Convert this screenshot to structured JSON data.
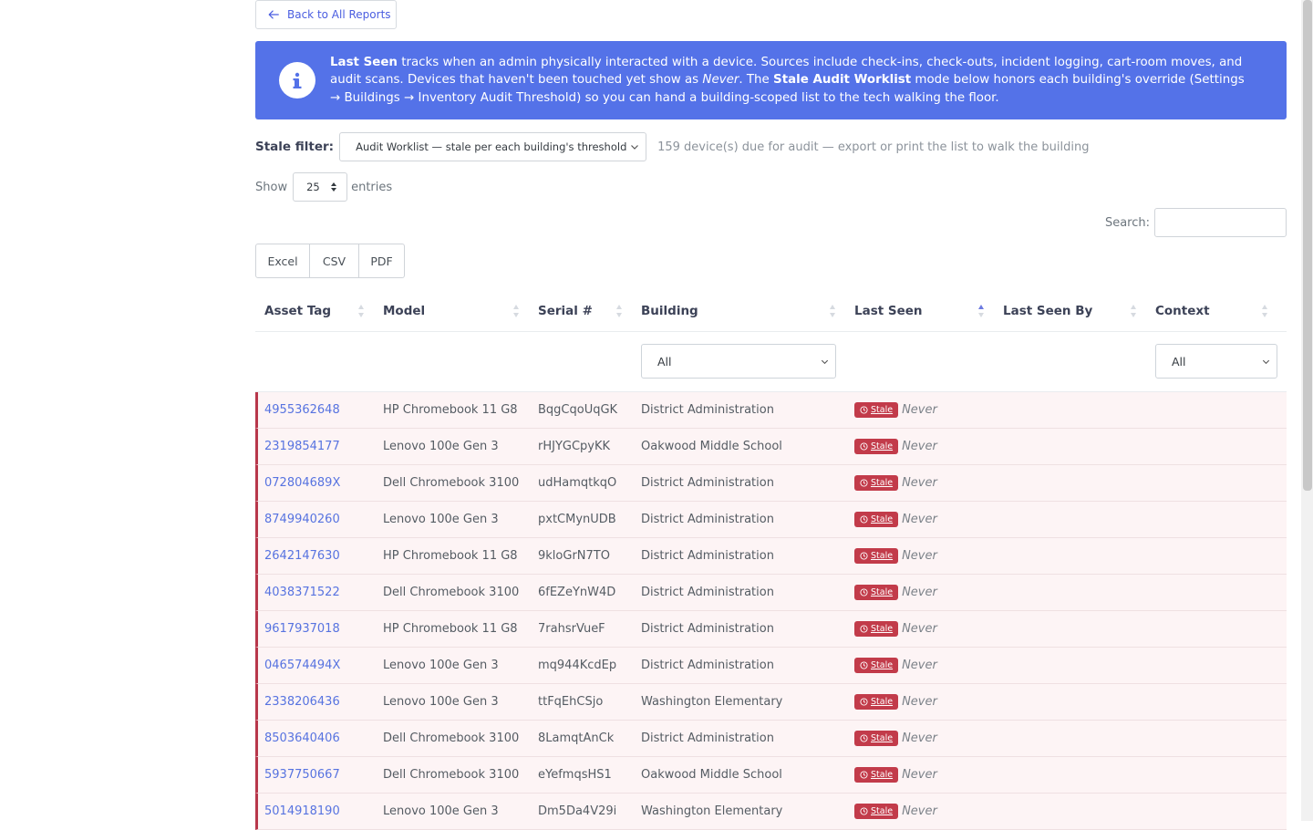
{
  "back_button": {
    "label": "Back to All Reports"
  },
  "info": {
    "term_last_seen": "Last Seen",
    "text_1": " tracks when an admin physically interacted with a device. Sources include check-ins, check-outs, incident logging, cart-room moves, and audit scans. Devices that haven't been touched yet show as ",
    "never_word": "Never",
    "text_2": ". The ",
    "term_audit": "Stale Audit Worklist",
    "text_3": " mode below honors each building's override (Settings → Buildings → Inventory Audit Threshold) so you can hand a building-scoped list to the tech walking the floor."
  },
  "stale_filter": {
    "label": "Stale filter:",
    "selected": "Audit Worklist — stale per each building's threshold",
    "note": "159 device(s) due for audit — export or print the list to walk the building"
  },
  "length_menu": {
    "show": "Show",
    "value": "25",
    "entries": "entries"
  },
  "search": {
    "label": "Search:"
  },
  "export_buttons": [
    "Excel",
    "CSV",
    "PDF"
  ],
  "columns": [
    "Asset Tag",
    "Model",
    "Serial #",
    "Building",
    "Last Seen",
    "Last Seen By",
    "Context"
  ],
  "filters": {
    "building": "All",
    "context": "All"
  },
  "stale_badge": "Stale",
  "never_text": "Never",
  "rows": [
    {
      "asset": "4955362648",
      "model": "HP Chromebook 11 G8",
      "serial": "BqgCqoUqGK",
      "building": "District Administration"
    },
    {
      "asset": "2319854177",
      "model": "Lenovo 100e Gen 3",
      "serial": "rHJYGCpyKK",
      "building": "Oakwood Middle School"
    },
    {
      "asset": "072804689X",
      "model": "Dell Chromebook 3100",
      "serial": "udHamqtkqO",
      "building": "District Administration"
    },
    {
      "asset": "8749940260",
      "model": "Lenovo 100e Gen 3",
      "serial": "pxtCMynUDB",
      "building": "District Administration"
    },
    {
      "asset": "2642147630",
      "model": "HP Chromebook 11 G8",
      "serial": "9kloGrN7TO",
      "building": "District Administration"
    },
    {
      "asset": "4038371522",
      "model": "Dell Chromebook 3100",
      "serial": "6fEZeYnW4D",
      "building": "District Administration"
    },
    {
      "asset": "9617937018",
      "model": "HP Chromebook 11 G8",
      "serial": "7rahsrVueF",
      "building": "District Administration"
    },
    {
      "asset": "046574494X",
      "model": "Lenovo 100e Gen 3",
      "serial": "mq944KcdEp",
      "building": "District Administration"
    },
    {
      "asset": "2338206436",
      "model": "Lenovo 100e Gen 3",
      "serial": "ttFqEhCSjo",
      "building": "Washington Elementary"
    },
    {
      "asset": "8503640406",
      "model": "Dell Chromebook 3100",
      "serial": "8LamqtAnCk",
      "building": "District Administration"
    },
    {
      "asset": "5937750667",
      "model": "Dell Chromebook 3100",
      "serial": "eYefmqsHS1",
      "building": "Oakwood Middle School"
    },
    {
      "asset": "5014918190",
      "model": "Lenovo 100e Gen 3",
      "serial": "Dm5Da4V29i",
      "building": "Washington Elementary"
    }
  ]
}
